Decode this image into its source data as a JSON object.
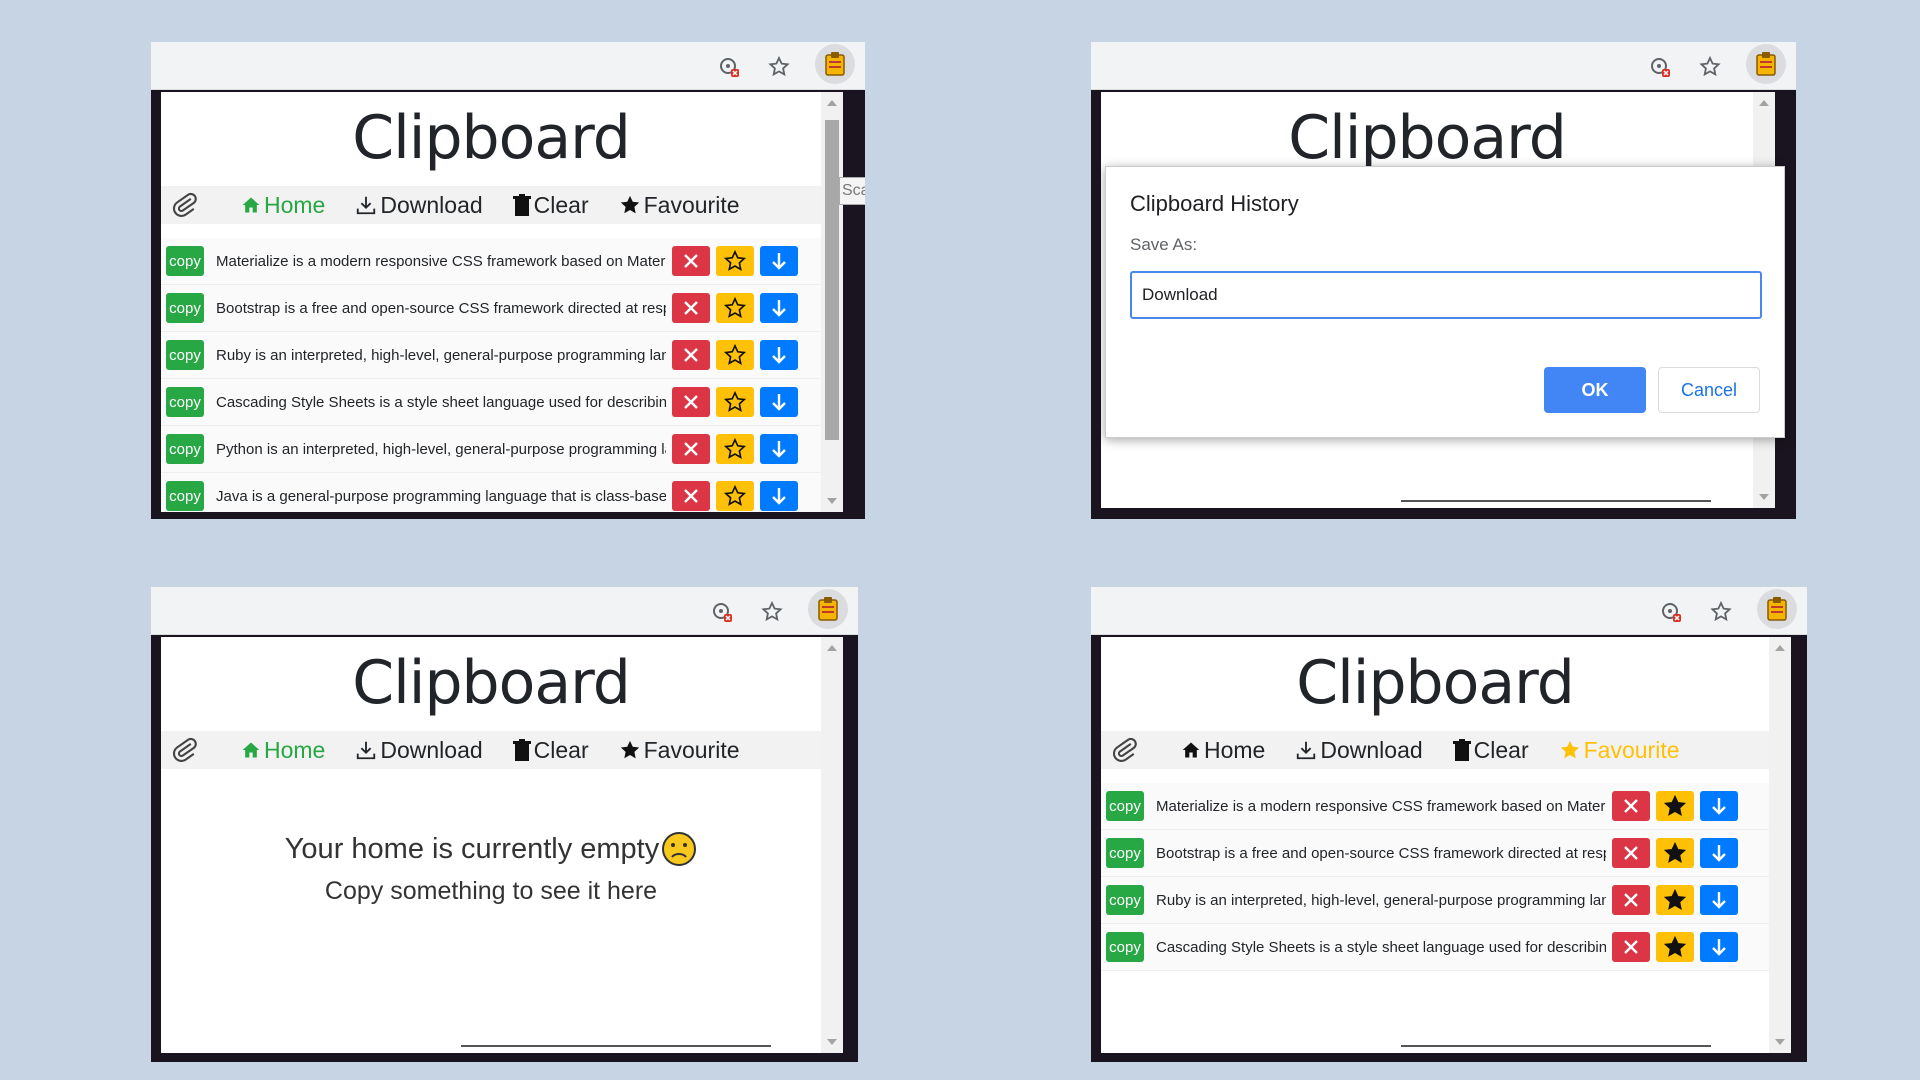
{
  "app_title": "Clipboard",
  "nav": {
    "home": "Home",
    "download": "Download",
    "clear": "Clear",
    "favourite": "Favourite"
  },
  "copy_label": "copy",
  "rows": [
    "Materialize is a modern responsive CSS framework based on Material Design",
    "Bootstrap is a free and open-source CSS framework directed at responsive",
    "Ruby is an interpreted, high-level, general-purpose programming language",
    "Cascading Style Sheets is a style sheet language used for describing the",
    "Python is an interpreted, high-level, general-purpose programming language",
    "Java is a general-purpose programming language that is class-based"
  ],
  "side_fragment": "Sca",
  "dialog": {
    "heading": "Clipboard History",
    "label": "Save As:",
    "input_value": "Download",
    "ok": "OK",
    "cancel": "Cancel"
  },
  "empty": {
    "line1": "Your home is currently empty",
    "line2": "Copy something to see it here"
  },
  "colors": {
    "green": "#28a745",
    "red": "#dc3545",
    "yellow": "#ffc107",
    "blue": "#007bff",
    "dialog_blue": "#4285f4"
  },
  "icons": [
    "paperclip-icon",
    "home-icon",
    "download-icon",
    "trash-icon",
    "star-icon",
    "close-icon",
    "arrow-down-icon",
    "bookmark-star-icon",
    "location-blocked-icon",
    "clipboard-extension-icon"
  ]
}
